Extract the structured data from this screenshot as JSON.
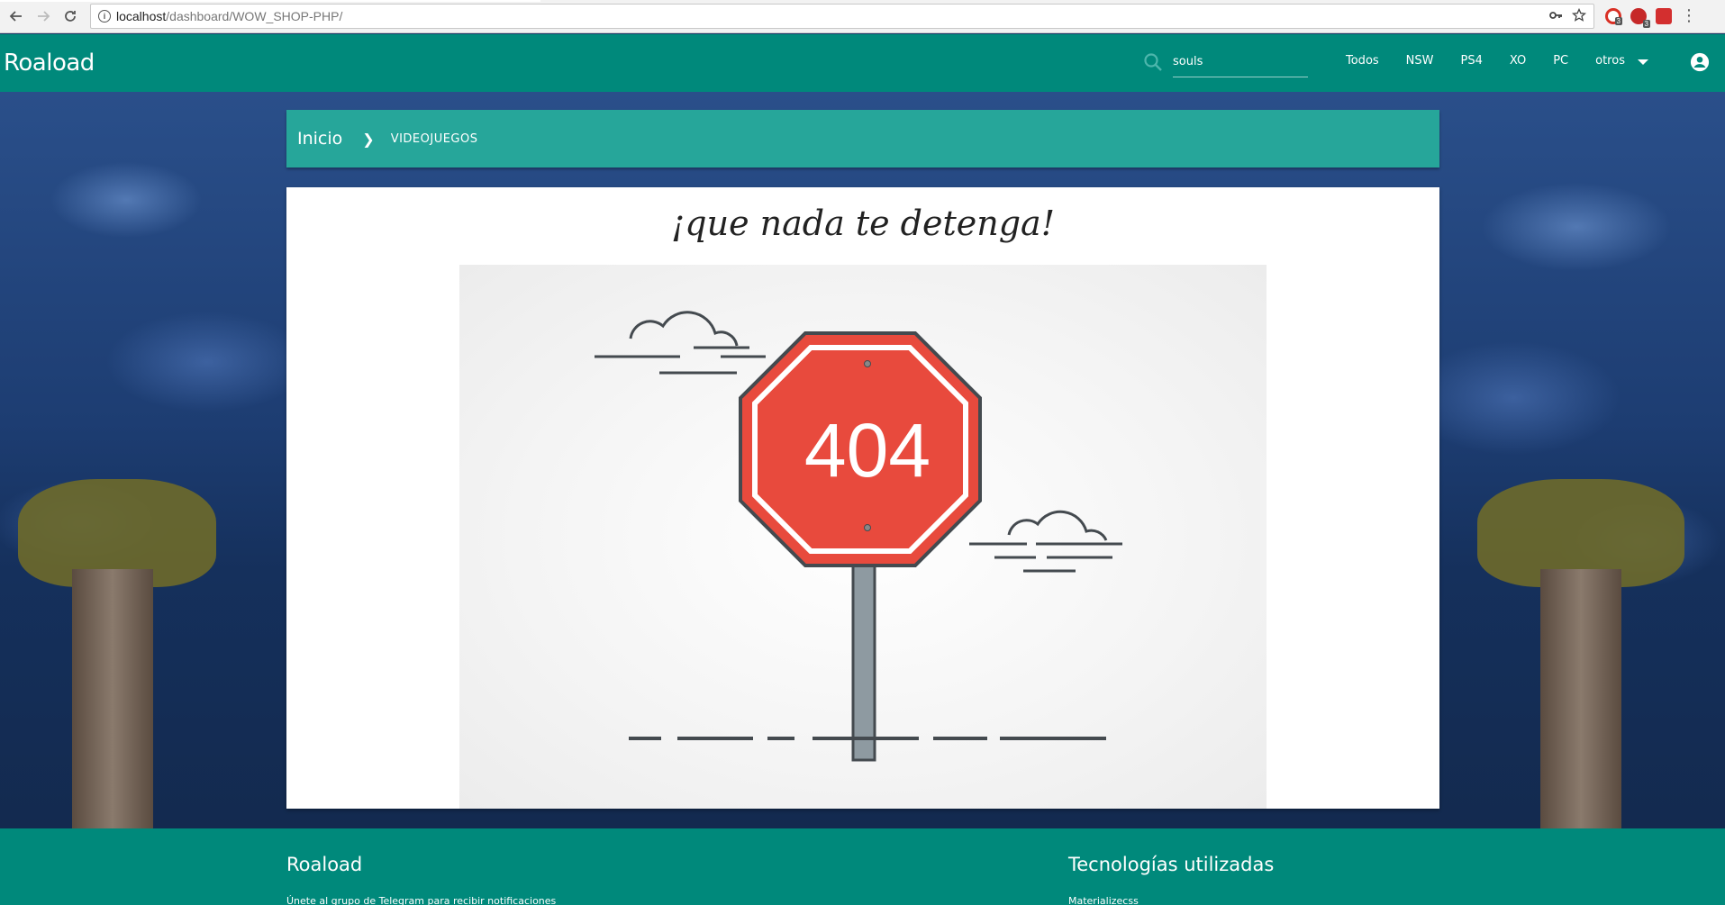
{
  "browser": {
    "url_host": "localhost",
    "url_path": "/dashboard/WOW_SHOP-PHP/",
    "extension_badge_1": "3",
    "extension_badge_2": "3"
  },
  "navbar": {
    "brand": "Roaload",
    "search_value": "souls",
    "links": [
      "Todos",
      "NSW",
      "PS4",
      "XO",
      "PC",
      "otros"
    ]
  },
  "breadcrumb": {
    "home": "Inicio",
    "current": "VIDEOJUEGOS"
  },
  "card": {
    "title": "¡que nada te detenga!",
    "sign_text": "404"
  },
  "footer": {
    "left_title": "Roaload",
    "left_text": "Únete al grupo de Telegram para recibir notificaciones",
    "right_title": "Tecnologías utilizadas",
    "right_text": "Materializecss"
  },
  "colors": {
    "navbar": "#00897b",
    "breadcrumb": "#26a69a",
    "sign_red": "#e84a3d",
    "outline": "#444a4f"
  }
}
